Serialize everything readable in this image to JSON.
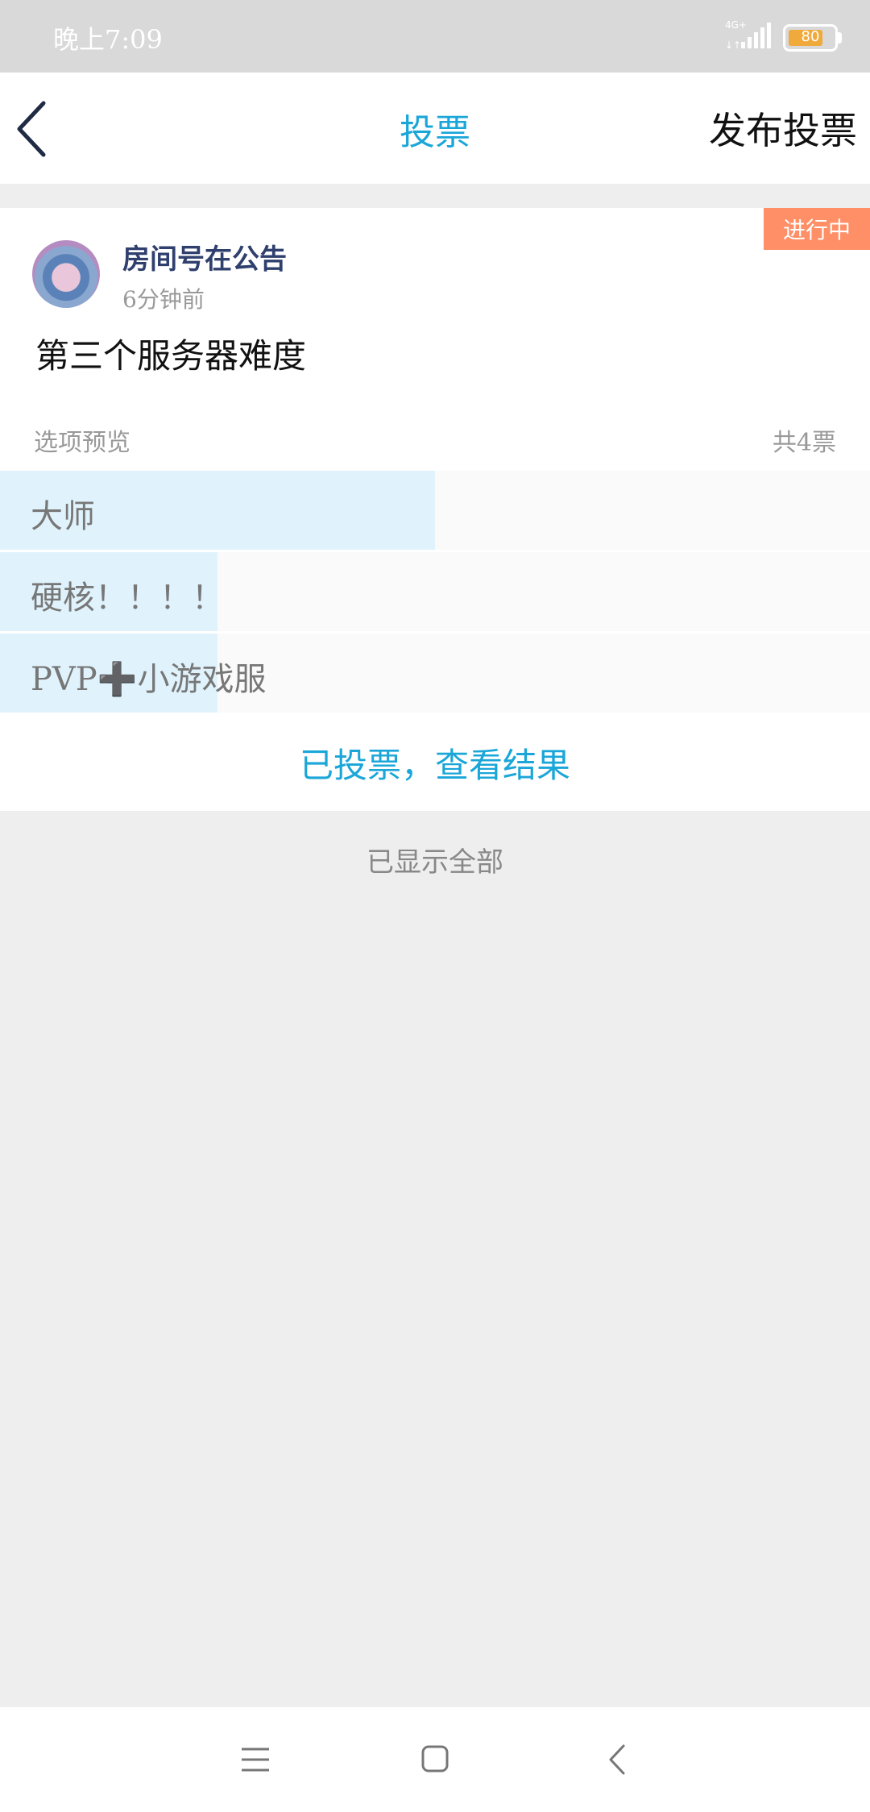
{
  "status_bar": {
    "time": "晚上7:09",
    "network": "4G+",
    "battery": "80",
    "battery_level": 0.8
  },
  "header": {
    "back_icon": "chevron-left-icon",
    "title": "投票",
    "publish_label": "发布投票"
  },
  "poll": {
    "status_tag": "进行中",
    "author": "房间号在公告",
    "time": "6分钟前",
    "title": "第三个服务器难度",
    "preview_label": "选项预览",
    "total_votes": "共4票",
    "options": [
      {
        "label": "大师",
        "share": 0.5
      },
      {
        "label": "硬核！！！！",
        "share": 0.25
      },
      {
        "label": "PVP➕小游戏服",
        "share": 0.25
      }
    ],
    "result_link": "已投票，查看结果"
  },
  "footer_text": "已显示全部",
  "nav": {
    "menu_icon": "menu-icon",
    "home_icon": "home-icon",
    "back_icon": "back-icon"
  },
  "colors": {
    "accent": "#1aa6d8",
    "tag": "#ff8f66",
    "option_fill": "#e0f3fc"
  }
}
